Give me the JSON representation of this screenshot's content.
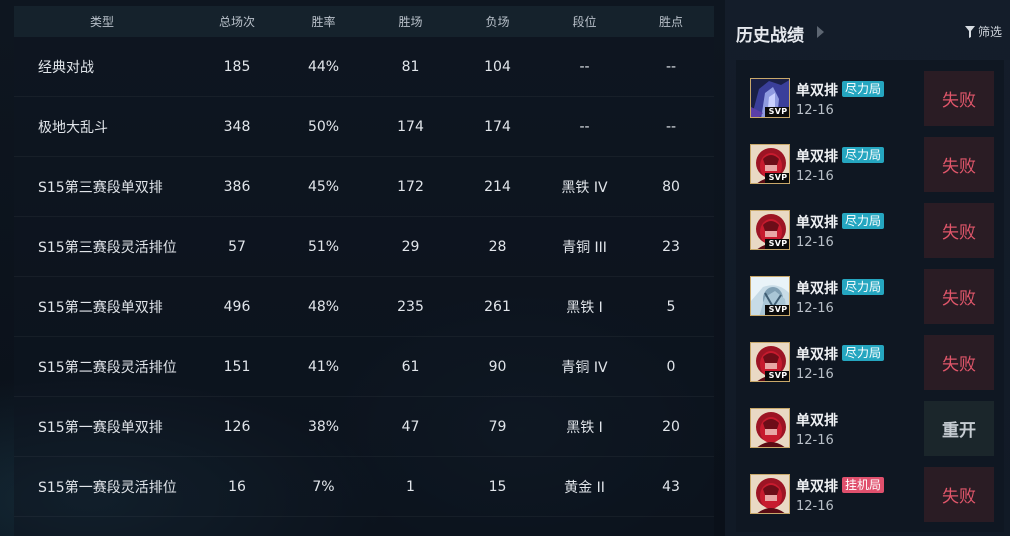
{
  "stats_table": {
    "headers": {
      "type": "类型",
      "total": "总场次",
      "win_rate": "胜率",
      "wins": "胜场",
      "losses": "负场",
      "tier": "段位",
      "lp": "胜点"
    },
    "rows": [
      {
        "type": "经典对战",
        "total": "185",
        "win_rate": "44%",
        "wins": "81",
        "losses": "104",
        "tier": "--",
        "lp": "--"
      },
      {
        "type": "极地大乱斗",
        "total": "348",
        "win_rate": "50%",
        "wins": "174",
        "losses": "174",
        "tier": "--",
        "lp": "--"
      },
      {
        "type": "S15第三赛段单双排",
        "total": "386",
        "win_rate": "45%",
        "wins": "172",
        "losses": "214",
        "tier": "黑铁 IV",
        "lp": "80"
      },
      {
        "type": "S15第三赛段灵活排位",
        "total": "57",
        "win_rate": "51%",
        "wins": "29",
        "losses": "28",
        "tier": "青铜 III",
        "lp": "23"
      },
      {
        "type": "S15第二赛段单双排",
        "total": "496",
        "win_rate": "48%",
        "wins": "235",
        "losses": "261",
        "tier": "黑铁 I",
        "lp": "5"
      },
      {
        "type": "S15第二赛段灵活排位",
        "total": "151",
        "win_rate": "41%",
        "wins": "61",
        "losses": "90",
        "tier": "青铜 IV",
        "lp": "0"
      },
      {
        "type": "S15第一赛段单双排",
        "total": "126",
        "win_rate": "38%",
        "wins": "47",
        "losses": "79",
        "tier": "黑铁 I",
        "lp": "20"
      },
      {
        "type": "S15第一赛段灵活排位",
        "total": "16",
        "win_rate": "7%",
        "wins": "1",
        "losses": "15",
        "tier": "黄金 II",
        "lp": "43"
      }
    ]
  },
  "history": {
    "title": "历史战绩",
    "filter_label": "筛选",
    "filter_icon": "funnel-icon",
    "header_arrow_icon": "chevron-right-icon",
    "matches": [
      {
        "mode": "单双排",
        "tag": "尽力局",
        "tag_kind": "effort",
        "date": "12-16",
        "result": "失败",
        "result_kind": "lose",
        "badge": "SVP",
        "avatar": "blue"
      },
      {
        "mode": "单双排",
        "tag": "尽力局",
        "tag_kind": "effort",
        "date": "12-16",
        "result": "失败",
        "result_kind": "lose",
        "badge": "SVP",
        "avatar": "red"
      },
      {
        "mode": "单双排",
        "tag": "尽力局",
        "tag_kind": "effort",
        "date": "12-16",
        "result": "失败",
        "result_kind": "lose",
        "badge": "SVP",
        "avatar": "red"
      },
      {
        "mode": "单双排",
        "tag": "尽力局",
        "tag_kind": "effort",
        "date": "12-16",
        "result": "失败",
        "result_kind": "lose",
        "badge": "SVP",
        "avatar": "ice"
      },
      {
        "mode": "单双排",
        "tag": "尽力局",
        "tag_kind": "effort",
        "date": "12-16",
        "result": "失败",
        "result_kind": "lose",
        "badge": "SVP",
        "avatar": "red"
      },
      {
        "mode": "单双排",
        "tag": "",
        "tag_kind": "",
        "date": "12-16",
        "result": "重开",
        "result_kind": "remake",
        "badge": "",
        "avatar": "red"
      },
      {
        "mode": "单双排",
        "tag": "挂机局",
        "tag_kind": "afk",
        "date": "12-16",
        "result": "失败",
        "result_kind": "lose",
        "badge": "",
        "avatar": "red"
      }
    ]
  },
  "colors": {
    "lose_text": "#e0566a",
    "effort_tag": "#25a6c0",
    "afk_tag": "#e0506d",
    "avatar_border": "#c8a86a"
  }
}
